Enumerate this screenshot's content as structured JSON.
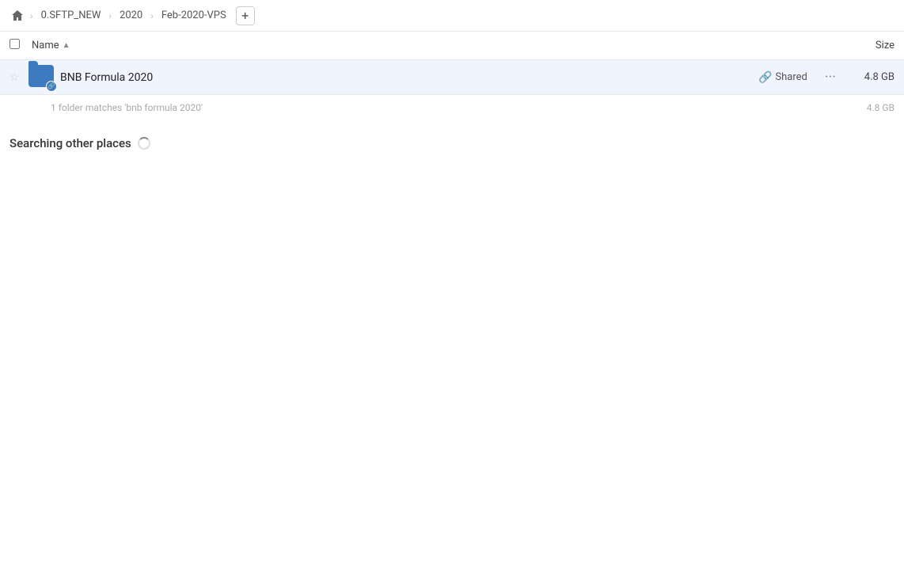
{
  "breadcrumb": {
    "home_icon": "home",
    "items": [
      {
        "label": "0.SFTP_NEW"
      },
      {
        "label": "2020"
      },
      {
        "label": "Feb-2020-VPS"
      }
    ],
    "add_button_label": "+"
  },
  "column_header": {
    "checkbox_label": "select-all",
    "name_label": "Name",
    "sort_indicator": "▲",
    "size_label": "Size"
  },
  "file_row": {
    "name": "BNB Formula 2020",
    "shared_label": "Shared",
    "size": "4.8 GB",
    "more_icon": "···"
  },
  "match_count": {
    "text": "1 folder matches 'bnb formula 2020'",
    "size": "4.8 GB"
  },
  "searching_section": {
    "text": "Searching other places"
  }
}
